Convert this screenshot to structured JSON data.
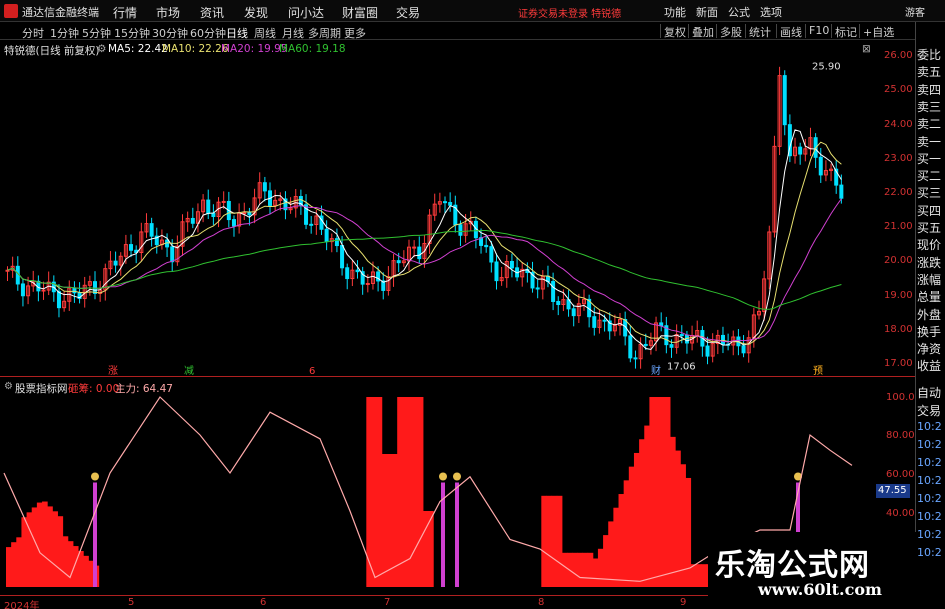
{
  "app": {
    "title": "通达信金融终端"
  },
  "menu": [
    "行情",
    "市场",
    "资讯",
    "发现",
    "问小达",
    "财富圈",
    "交易"
  ],
  "warning": "证券交易未登录  特锐德",
  "top_right": [
    "功能",
    "新面",
    "公式",
    "选项",
    "游客"
  ],
  "periods": [
    "分时",
    "1分钟",
    "5分钟",
    "15分钟",
    "30分钟",
    "60分钟",
    "日线",
    "周线",
    "月线",
    "多周期",
    "更多"
  ],
  "active_period": "日线",
  "toolbar": [
    "复权",
    "叠加",
    "多股",
    "统计",
    "画线",
    "F10",
    "标记",
    "+自选"
  ],
  "stock_legend": {
    "name": "特锐德(日线 前复权)",
    "ma5": "MA5: 22.42",
    "ma10": "MA10: 22.26",
    "ma20": "MA20: 19.95",
    "ma60": "MA60: 19.18"
  },
  "right_panel": [
    "委比",
    "卖五",
    "卖四",
    "卖三",
    "卖二",
    "卖一",
    "买一",
    "买二",
    "买三",
    "买四",
    "买五",
    "现价",
    "涨跌",
    "涨幅",
    "总量",
    "外盘",
    "换手",
    "净资",
    "收益"
  ],
  "right_panel_lower": [
    "自动",
    "交易",
    "10:2",
    "10:2",
    "10:2",
    "10:2",
    "10:2",
    "10:2",
    "10:2",
    "10:2"
  ],
  "indicator_legend": {
    "name": "股票指标网",
    "item1": "砸筹: 0.00",
    "item2": "主力: 64.47"
  },
  "price_labels": {
    "high": "25.90",
    "low": "17.06",
    "current_marker": "47.55"
  },
  "event_marks": [
    "涨",
    "减",
    "6",
    "财",
    "预"
  ],
  "price_axis": [
    "26.00",
    "25.00",
    "24.00",
    "23.00",
    "22.00",
    "21.00",
    "20.00",
    "19.00",
    "18.00",
    "17.00"
  ],
  "ind_axis": [
    "100.0",
    "80.00",
    "60.00",
    "40.00"
  ],
  "date_axis": [
    "2024年",
    "5",
    "6",
    "7",
    "8",
    "9"
  ],
  "watermark": {
    "cn": "乐淘公式网",
    "url": "www.60lt.com"
  },
  "colors": {
    "up": "#ff3b3b",
    "down": "#00e0ff",
    "ma5": "#ffffff",
    "ma10": "#e8e070",
    "ma20": "#d040d0",
    "ma60": "#30c030",
    "line": "#ffaaaa",
    "bar": "#ff1a1a",
    "marker": "#d040d0"
  }
}
